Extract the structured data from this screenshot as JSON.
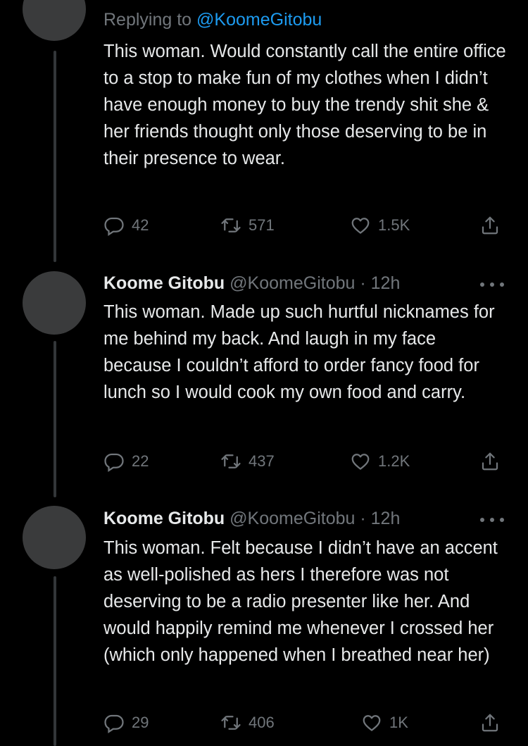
{
  "tweets": [
    {
      "reply_prefix": "Replying to",
      "reply_mention": "@KoomeGitobu",
      "text": "This woman. Would constantly call the entire office to a stop to make fun of my clothes when I didn’t have enough money to buy the trendy shit she & her friends thought only those deserving to be in their presence to wear.",
      "replies": "42",
      "retweets": "571",
      "likes": "1.5K"
    },
    {
      "name": "Koome Gitobu",
      "handle": "@KoomeGitobu",
      "dot": "·",
      "time": "12h",
      "text": "This woman. Made up such hurtful nicknames for me behind my back. And laugh in my face because I couldn’t afford to order fancy food for lunch so I would cook my own food and carry.",
      "replies": "22",
      "retweets": "437",
      "likes": "1.2K"
    },
    {
      "name": "Koome Gitobu",
      "handle": "@KoomeGitobu",
      "dot": "·",
      "time": "12h",
      "text": "This woman. Felt because I didn’t have an accent as well-polished as hers I therefore was not deserving to be a radio presenter like her. And would happily remind me whenever I crossed her (which only happened when I breathed near her)",
      "replies": "29",
      "retweets": "406",
      "likes": "1K"
    }
  ],
  "icons": {
    "reply": "reply-icon",
    "retweet": "retweet-icon",
    "like": "heart-icon",
    "share": "share-icon",
    "more": "more-icon"
  },
  "colors": {
    "background": "#000000",
    "text": "#e7e9ea",
    "muted": "#71767b",
    "link": "#1d9bf0",
    "thread": "#333639"
  }
}
